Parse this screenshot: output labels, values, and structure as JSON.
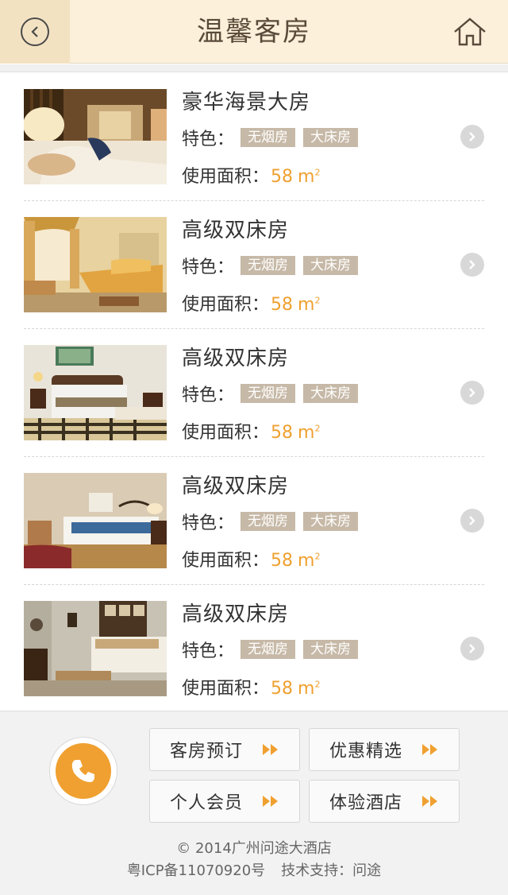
{
  "header": {
    "title": "温馨客房",
    "back_icon": "back-arrow-circle-icon",
    "home_icon": "home-icon"
  },
  "rooms": [
    {
      "name": "豪华海景大房",
      "feature_label": "特色：",
      "tags": [
        "无烟房",
        "大床房"
      ],
      "area_label": "使用面积：",
      "area_value": "58",
      "area_unit": "m",
      "unit_sup": "2"
    },
    {
      "name": "高级双床房",
      "feature_label": "特色：",
      "tags": [
        "无烟房",
        "大床房"
      ],
      "area_label": "使用面积：",
      "area_value": "58",
      "area_unit": "m",
      "unit_sup": "2"
    },
    {
      "name": "高级双床房",
      "feature_label": "特色：",
      "tags": [
        "无烟房",
        "大床房"
      ],
      "area_label": "使用面积：",
      "area_value": "58",
      "area_unit": "m",
      "unit_sup": "2"
    },
    {
      "name": "高级双床房",
      "feature_label": "特色：",
      "tags": [
        "无烟房",
        "大床房"
      ],
      "area_label": "使用面积：",
      "area_value": "58",
      "area_unit": "m",
      "unit_sup": "2"
    },
    {
      "name": "高级双床房",
      "feature_label": "特色：",
      "tags": [
        "无烟房",
        "大床房"
      ],
      "area_label": "使用面积：",
      "area_value": "58",
      "area_unit": "m",
      "unit_sup": "2"
    }
  ],
  "footer": {
    "nav": [
      {
        "label": "客房预订"
      },
      {
        "label": "优惠精选"
      },
      {
        "label": "个人会员"
      },
      {
        "label": "体验酒店"
      }
    ],
    "copyright": "© 2014广州问途大酒店",
    "icp": "粤ICP备11070920号",
    "support": "技术支持：问途"
  },
  "colors": {
    "accent": "#f0a030",
    "header_bg": "#fcf0da",
    "tag_bg": "#c7b9a7"
  }
}
